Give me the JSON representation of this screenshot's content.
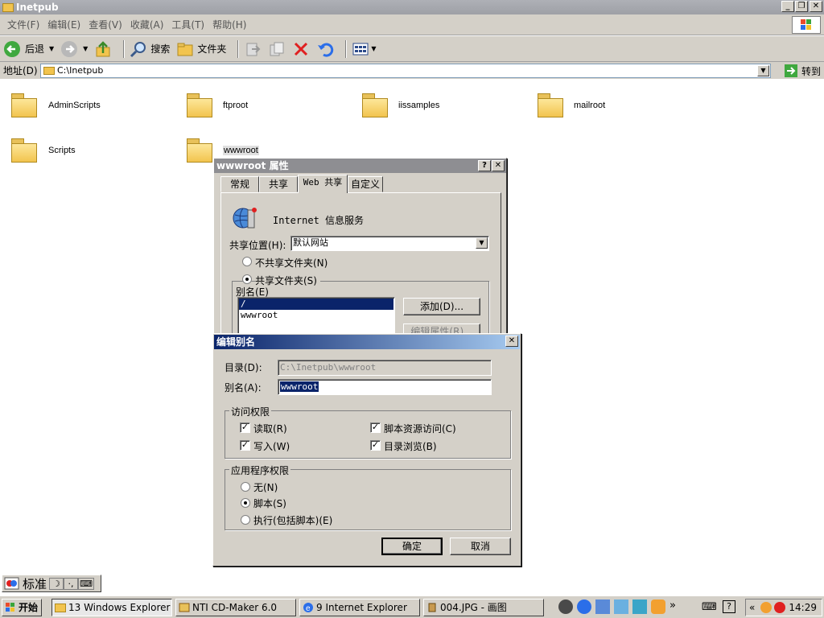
{
  "window": {
    "title": "Inetpub"
  },
  "menu": [
    "文件(F)",
    "编辑(E)",
    "查看(V)",
    "收藏(A)",
    "工具(T)",
    "帮助(H)"
  ],
  "toolbar": {
    "back": "后退",
    "search": "搜索",
    "folders": "文件夹"
  },
  "address": {
    "label": "地址(D)",
    "value": "C:\\Inetpub",
    "go": "转到"
  },
  "folders": [
    "AdminScripts",
    "ftproot",
    "iissamples",
    "mailroot",
    "Scripts",
    "wwwroot"
  ],
  "props_dialog": {
    "title": "wwwroot 属性",
    "tabs": [
      "常规",
      "共享",
      "Web 共享",
      "自定义"
    ],
    "service_label": "Internet 信息服务",
    "share_location_label": "共享位置(H):",
    "share_location_value": "默认网站",
    "radio_no_share": "不共享文件夹(N)",
    "radio_share": "共享文件夹(S)",
    "alias_group": "别名(E)",
    "aliases": [
      "/",
      "wwwroot"
    ],
    "add_button": "添加(D)...",
    "edit_button": "编辑属性(R)..."
  },
  "edit_dialog": {
    "title": "编辑别名",
    "dir_label": "目录(D):",
    "dir_value": "C:\\Inetpub\\wwwroot",
    "alias_label": "别名(A):",
    "alias_value": "wwwroot",
    "access_group": "访问权限",
    "access": {
      "read": "读取(R)",
      "script_source": "脚本资源访问(C)",
      "write": "写入(W)",
      "dir_browse": "目录浏览(B)"
    },
    "app_group": "应用程序权限",
    "app": {
      "none": "无(N)",
      "scripts": "脚本(S)",
      "execute": "执行(包括脚本)(E)"
    },
    "ok": "确定",
    "cancel": "取消"
  },
  "ime": {
    "mode": "标准"
  },
  "taskbar": {
    "start": "开始",
    "tasks": [
      "13 Windows Explorer",
      "NTI CD-Maker 6.0",
      "9 Internet Explorer",
      "004.JPG - 画图"
    ],
    "clock": "14:29"
  }
}
